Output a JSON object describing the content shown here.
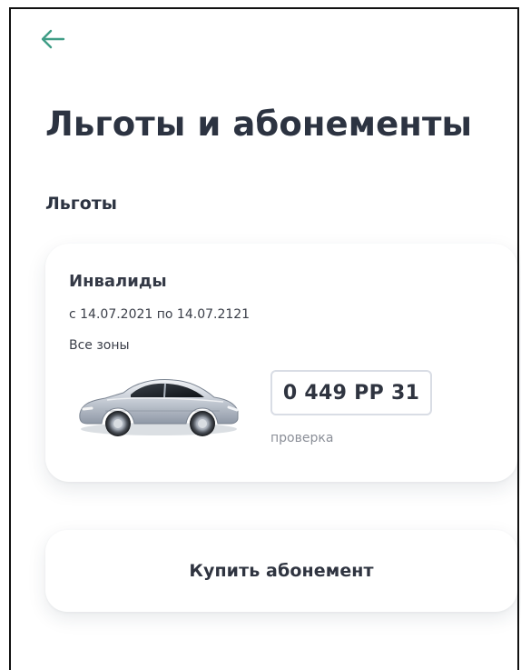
{
  "header": {
    "back_icon": "arrow-left-icon",
    "back_icon_color": "#3f9d86"
  },
  "page": {
    "title": "Льготы и абонементы"
  },
  "benefits_section": {
    "title": "Льготы",
    "card": {
      "category": "Инвалиды",
      "period": "с 14.07.2021 по 14.07.2121",
      "zones": "Все зоны",
      "vehicle_image": "silver-sedan",
      "plate_number": "0 449 РР 31",
      "plate_status": "проверка"
    }
  },
  "actions": {
    "buy_subscription_label": "Купить абонемент"
  }
}
